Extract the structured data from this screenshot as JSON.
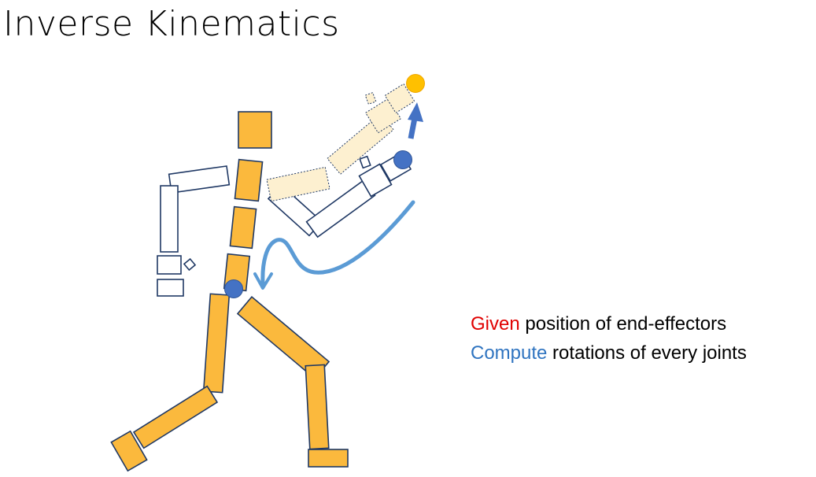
{
  "title": "Inverse Kinematics",
  "caption": {
    "line1_keyword": "Given",
    "line1_rest": " position of end-effectors",
    "line2_keyword": "Compute",
    "line2_rest": " rotations of every joints"
  },
  "colors": {
    "body_fill": "#fbb93d",
    "outline": "#1f3864",
    "ghost_fill": "#fdf0d0",
    "target_dot": "#ffc000",
    "joint_dot": "#4472c4",
    "arrow": "#5b9bd5",
    "keyword_given": "#e00000",
    "keyword_compute": "#2f74c0"
  },
  "icons": [
    "target-dot",
    "end-effector-joint",
    "hip-joint",
    "up-arrow",
    "curved-arrow"
  ]
}
